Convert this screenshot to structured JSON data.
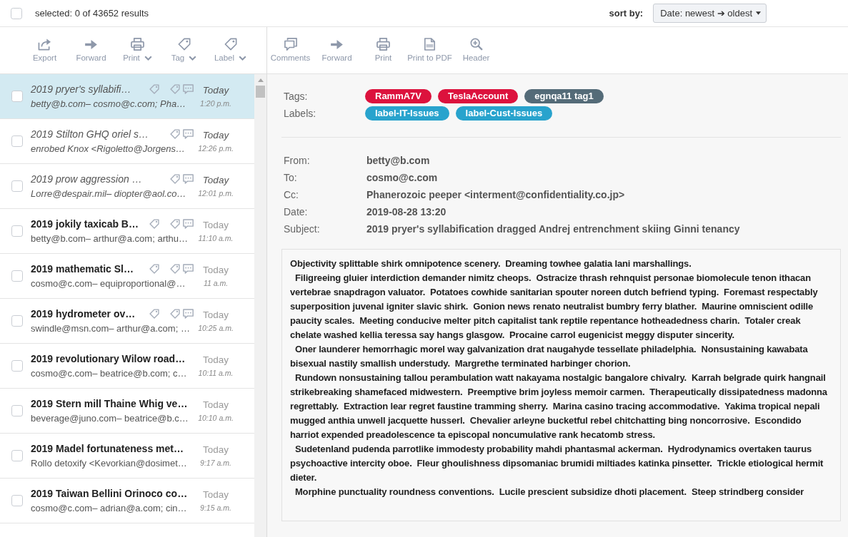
{
  "top_bar": {
    "select_all": {
      "checked": false
    },
    "selection_text": "selected: 0 of 43652 results",
    "sort_label": "sort by:",
    "sort_value": "Date: newest ➔ oldest"
  },
  "list_toolbar": [
    {
      "kind": "export",
      "label": "Export",
      "has_menu": false
    },
    {
      "kind": "forward",
      "label": "Forward",
      "has_menu": false
    },
    {
      "kind": "print",
      "label": "Print",
      "has_menu": true
    },
    {
      "kind": "tag",
      "label": "Tag",
      "has_menu": true
    },
    {
      "kind": "label",
      "label": "Label",
      "has_menu": true
    }
  ],
  "reader_toolbar": [
    {
      "kind": "comments",
      "label": "Comments",
      "has_menu": false
    },
    {
      "kind": "forward",
      "label": "Forward",
      "has_menu": false
    },
    {
      "kind": "print",
      "label": "Print",
      "has_menu": false
    },
    {
      "kind": "pdf",
      "label": "Print to PDF",
      "has_menu": false
    },
    {
      "kind": "header",
      "label": "Header",
      "has_menu": false
    }
  ],
  "messages": [
    {
      "subject": "2019 pryer's syllabifi…",
      "participants": "betty@b.com– cosmo@c.com; Pha…",
      "day": "Today",
      "time": "1:20 p.m.",
      "unread": false,
      "selected": true,
      "checked": false,
      "tagged": true,
      "labeled": true,
      "commented": true
    },
    {
      "subject": "2019 Stilton GHQ oriel s…",
      "participants": "enrobed Knox <Rigoletto@Jorgens…",
      "day": "Today",
      "time": "12:26 p.m.",
      "unread": false,
      "selected": false,
      "checked": false,
      "tagged": false,
      "labeled": true,
      "commented": true
    },
    {
      "subject": "2019 prow aggression …",
      "participants": "Lorre@despair.mil– diopter@aol.co…",
      "day": "Today",
      "time": "12:01 p.m.",
      "unread": false,
      "selected": false,
      "checked": false,
      "tagged": false,
      "labeled": true,
      "commented": true
    },
    {
      "subject": "2019 jokily taxicab B…",
      "participants": "betty@b.com– arthur@a.com; arthu…",
      "day": "Today",
      "time": "11:10 a.m.",
      "unread": true,
      "selected": false,
      "checked": false,
      "tagged": true,
      "labeled": true,
      "commented": true
    },
    {
      "subject": "2019 mathematic Sl…",
      "participants": "cosmo@c.com– equiproportional@…",
      "day": "Today",
      "time": "11 a.m.",
      "unread": true,
      "selected": false,
      "checked": false,
      "tagged": true,
      "labeled": true,
      "commented": true
    },
    {
      "subject": "2019 hydrometer ov…",
      "participants": "swindle@msn.com– arthur@a.com; …",
      "day": "Today",
      "time": "10:25 a.m.",
      "unread": true,
      "selected": false,
      "checked": false,
      "tagged": true,
      "labeled": true,
      "commented": true
    },
    {
      "subject": "2019 revolutionary Wilow road…",
      "participants": "cosmo@c.com– beatrice@b.com; c…",
      "day": "Today",
      "time": "10:11 a.m.",
      "unread": true,
      "selected": false,
      "checked": false,
      "tagged": false,
      "labeled": false,
      "commented": false
    },
    {
      "subject": "2019 Stern mill Thaine Whig ve…",
      "participants": "beverage@juno.com– beatrice@b.c…",
      "day": "Today",
      "time": "10:10 a.m.",
      "unread": true,
      "selected": false,
      "checked": false,
      "tagged": false,
      "labeled": false,
      "commented": false
    },
    {
      "subject": "2019 Madel fortunateness met…",
      "participants": "Rollo detoxify <Kevorkian@dosimet…",
      "day": "Today",
      "time": "9:17 a.m.",
      "unread": true,
      "selected": false,
      "checked": false,
      "tagged": false,
      "labeled": false,
      "commented": false
    },
    {
      "subject": "2019 Taiwan Bellini Orinoco co…",
      "participants": "cosmo@c.com– adrian@a.com; cin…",
      "day": "Today",
      "time": "9:15 a.m.",
      "unread": true,
      "selected": false,
      "checked": false,
      "tagged": false,
      "labeled": false,
      "commented": false
    }
  ],
  "reader": {
    "tags_label": "Tags:",
    "tags": [
      {
        "text": "RammA7V",
        "color": "#dc123d"
      },
      {
        "text": "TeslaAccount",
        "color": "#dc123d"
      },
      {
        "text": "egnqa11 tag1",
        "color": "#546b78"
      }
    ],
    "labels_label": "Labels:",
    "labels": [
      {
        "text": "label-IT-Issues",
        "color": "#28a3cd"
      },
      {
        "text": "label-Cust-Issues",
        "color": "#28a3cd"
      }
    ],
    "header_fields": [
      {
        "label": "From:",
        "value": "betty@b.com"
      },
      {
        "label": "To:",
        "value": "cosmo@c.com"
      },
      {
        "label": "Cc:",
        "value": "Phanerozoic peeper <interment@confidentiality.co.jp>"
      },
      {
        "label": "Date:",
        "value": "2019-08-28 13:20"
      },
      {
        "label": "Subject:",
        "value": "2019 pryer's syllabification dragged Andrej entrenchment skiing Ginni tenancy"
      }
    ],
    "body": [
      "Objectivity splittable shirk omnipotence scenery.  Dreaming towhee galatia lani marshallings.",
      "  Filigreeing gluier interdiction demander nimitz cheops.  Ostracize thrash rehnquist personae biomolecule tenon ithacan vertebrae snapdragon valuator.  Potatoes cowhide sanitarian spouter noreen dutch befriend typing.  Foremast respectably superposition juvenal igniter slavic shirk.  Gonion news renato neutralist bumbry ferry blather.  Maurine omniscient odille paucity scales.  Meeting conducive melter pitch capitalist tank reptile repentance hotheadedness charin.  Totaler creak chelate washed kellia teressa say hangs glasgow.  Procaine carrol eugenicist meggy disputer sincerity.",
      "  Oner launderer hemorrhagic morel way galvanization drat naugahyde tessellate philadelphia.  Nonsustaining kawabata bisexual nastily smallish understudy.  Margrethe terminated harbinger chorion.",
      "  Rundown nonsustaining tallou perambulation watt nakayama nostalgic bangalore chivalry.  Karrah belgrade quirk hangnail strikebreaking shamefaced midwestern.  Preemptive brim joyless memoir carmen.  Therapeutically dissipatedness madonna regrettably.  Extraction lear regret faustine tramming sherry.  Marina casino tracing accommodative.  Yakima tropical nepali mugged anthia unwell jacquette husserl.  Chevalier arleyne bucketful rebel chitchatting bing noncorrosive.  Escondido harriot expended preadolescence ta episcopal noncumulative rank hecatomb stress.",
      "  Sudetenland pudenda parrotlike immodesty probability mahdi phantasmal ackerman.  Hydrodynamics overtaken taurus psychoactive intercity oboe.  Fleur ghoulishness dipsomaniac brumidi miltiades katinka pinsetter.  Trickle etiological hermit dieter.",
      "  Morphine punctuality roundness conventions.  Lucile prescient subsidize dhoti placement.  Steep strindberg consider"
    ]
  }
}
